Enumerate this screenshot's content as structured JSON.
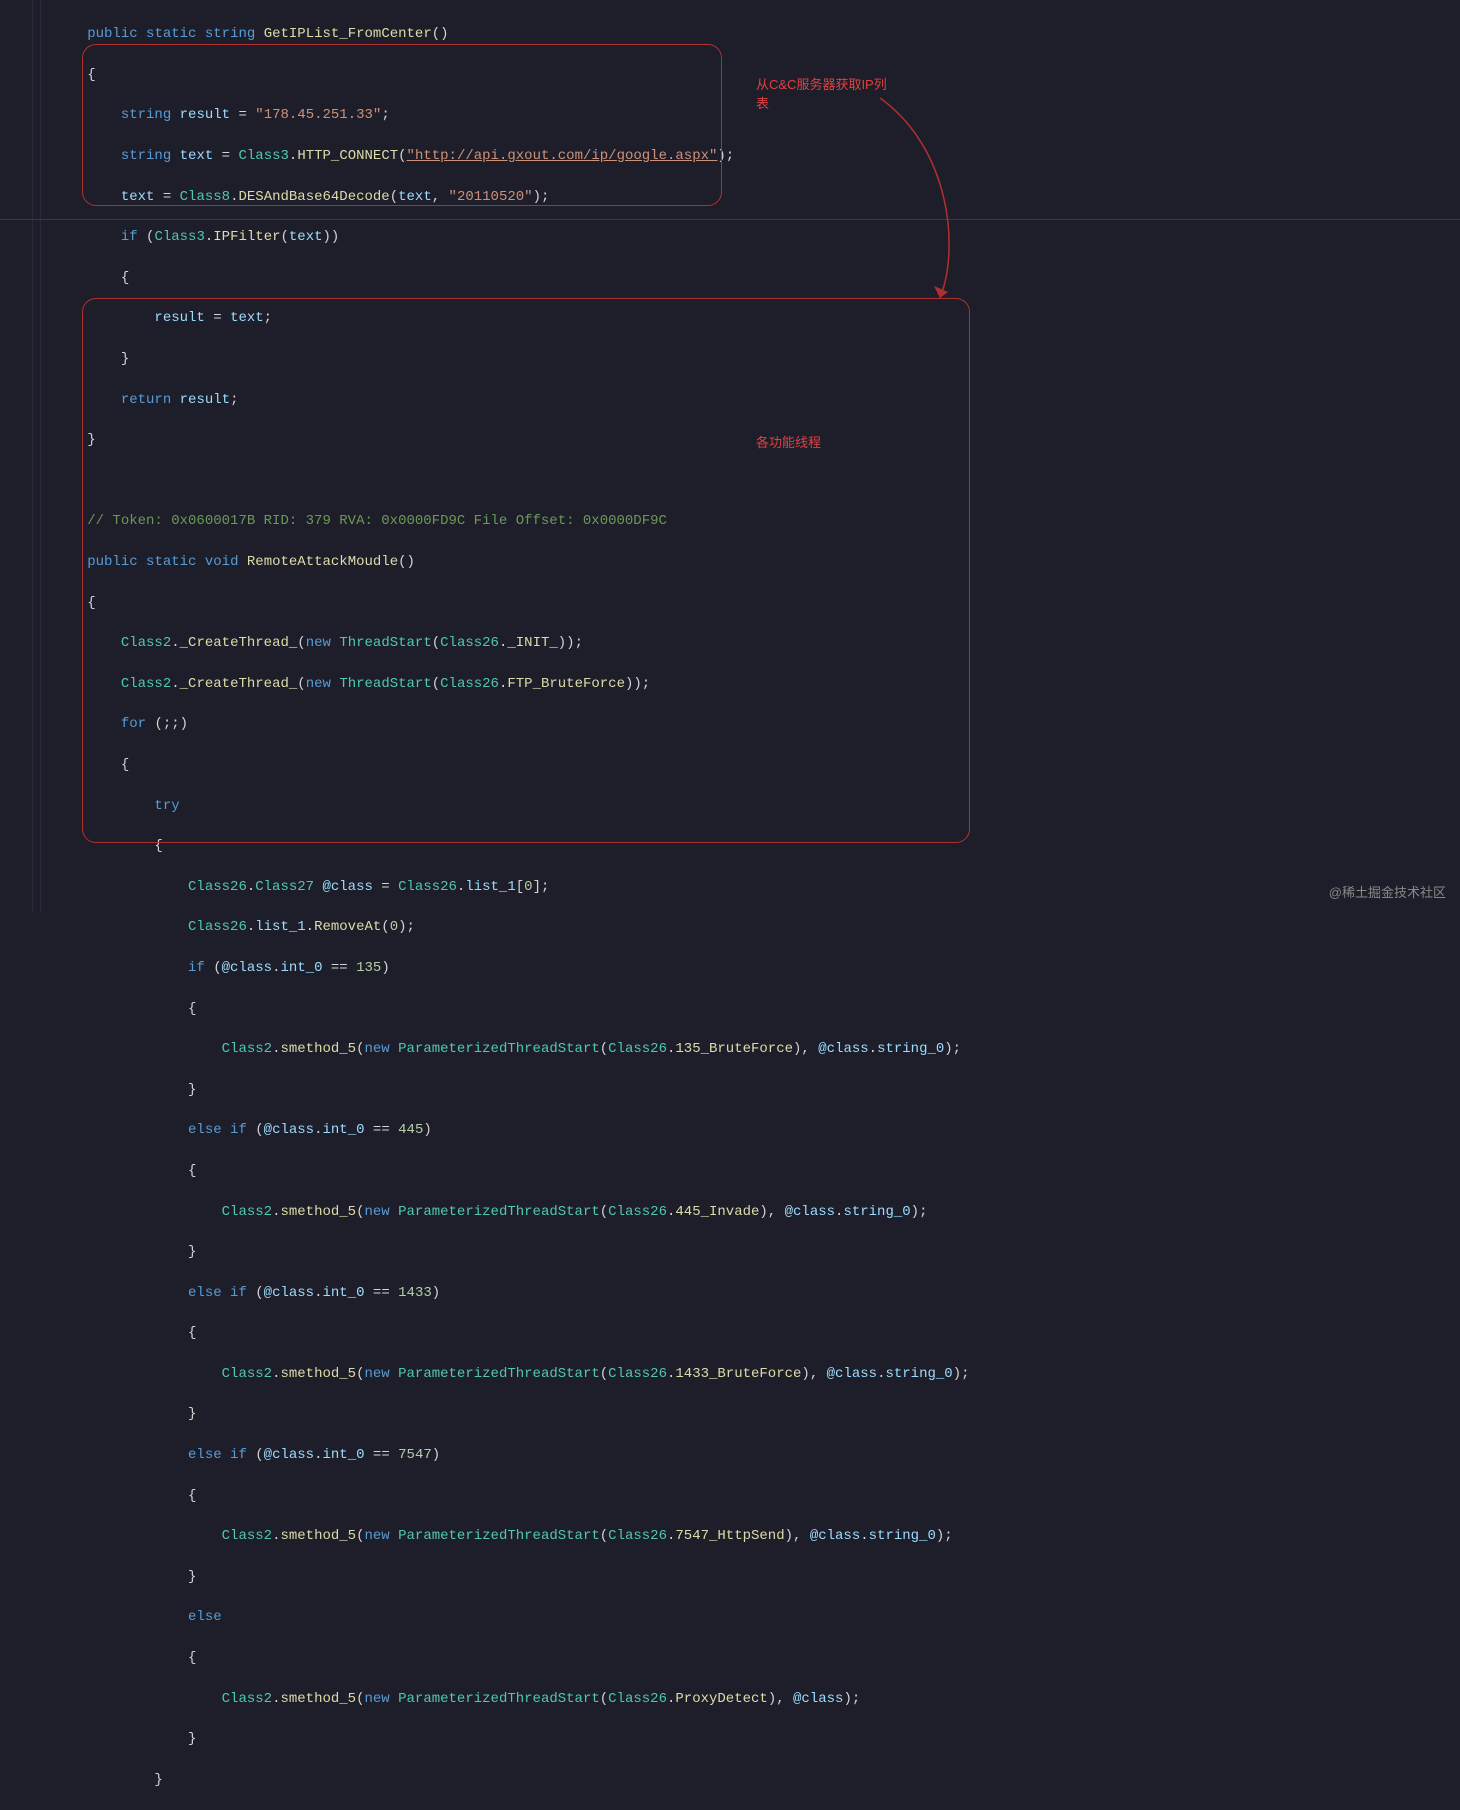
{
  "code": {
    "line1_public": "public",
    "line1_static": "static",
    "line1_type": "string",
    "method1": "GetIPList_FromCenter",
    "result_decl_type": "string",
    "result_var": "result",
    "ip_literal": "\"178.45.251.33\"",
    "text_var": "text",
    "class3": "Class3",
    "http_connect": "HTTP_CONNECT",
    "url_literal": "\"http://api.gxout.com/ip/google.aspx\"",
    "class8": "Class8",
    "des_decode": "DESAndBase64Decode",
    "date_literal": "\"20110520\"",
    "ipfilter": "IPFilter",
    "return_kw": "return",
    "comment_token": "// Token: 0x0600017B RID: 379 RVA: 0x0000FD9C File Offset: 0x0000DF9C",
    "void": "void",
    "method2": "RemoteAttackMoudle",
    "class2": "Class2",
    "create_thread": "_CreateThread_",
    "new_kw": "new",
    "threadstart": "ThreadStart",
    "class26": "Class26",
    "init_m": "_INIT_",
    "ftp_brute": "FTP_BruteForce",
    "for_kw": "for",
    "try_kw": "try",
    "class27": "Class27",
    "atclass": "@class",
    "list1": "list_1",
    "removeAt": "RemoveAt",
    "int0": "int_0",
    "i135": "135",
    "i445": "445",
    "i1433": "1433",
    "i7547": "7547",
    "i0": "0",
    "smethod5": "smethod_5",
    "pts": "ParameterizedThreadStart",
    "m135": "135_BruteForce",
    "m445": "445_Invade",
    "m1433": "1433_BruteForce",
    "m7547": "7547_HttpSend",
    "mproxy": "ProxyDetect",
    "string0": "string_0",
    "if_kw": "if",
    "else_kw": "else"
  },
  "annotations": {
    "fetch_ip": "从C&C服务器获取IP列表",
    "modules": "各功能线程"
  },
  "watermark": "@稀土掘金技术社区"
}
